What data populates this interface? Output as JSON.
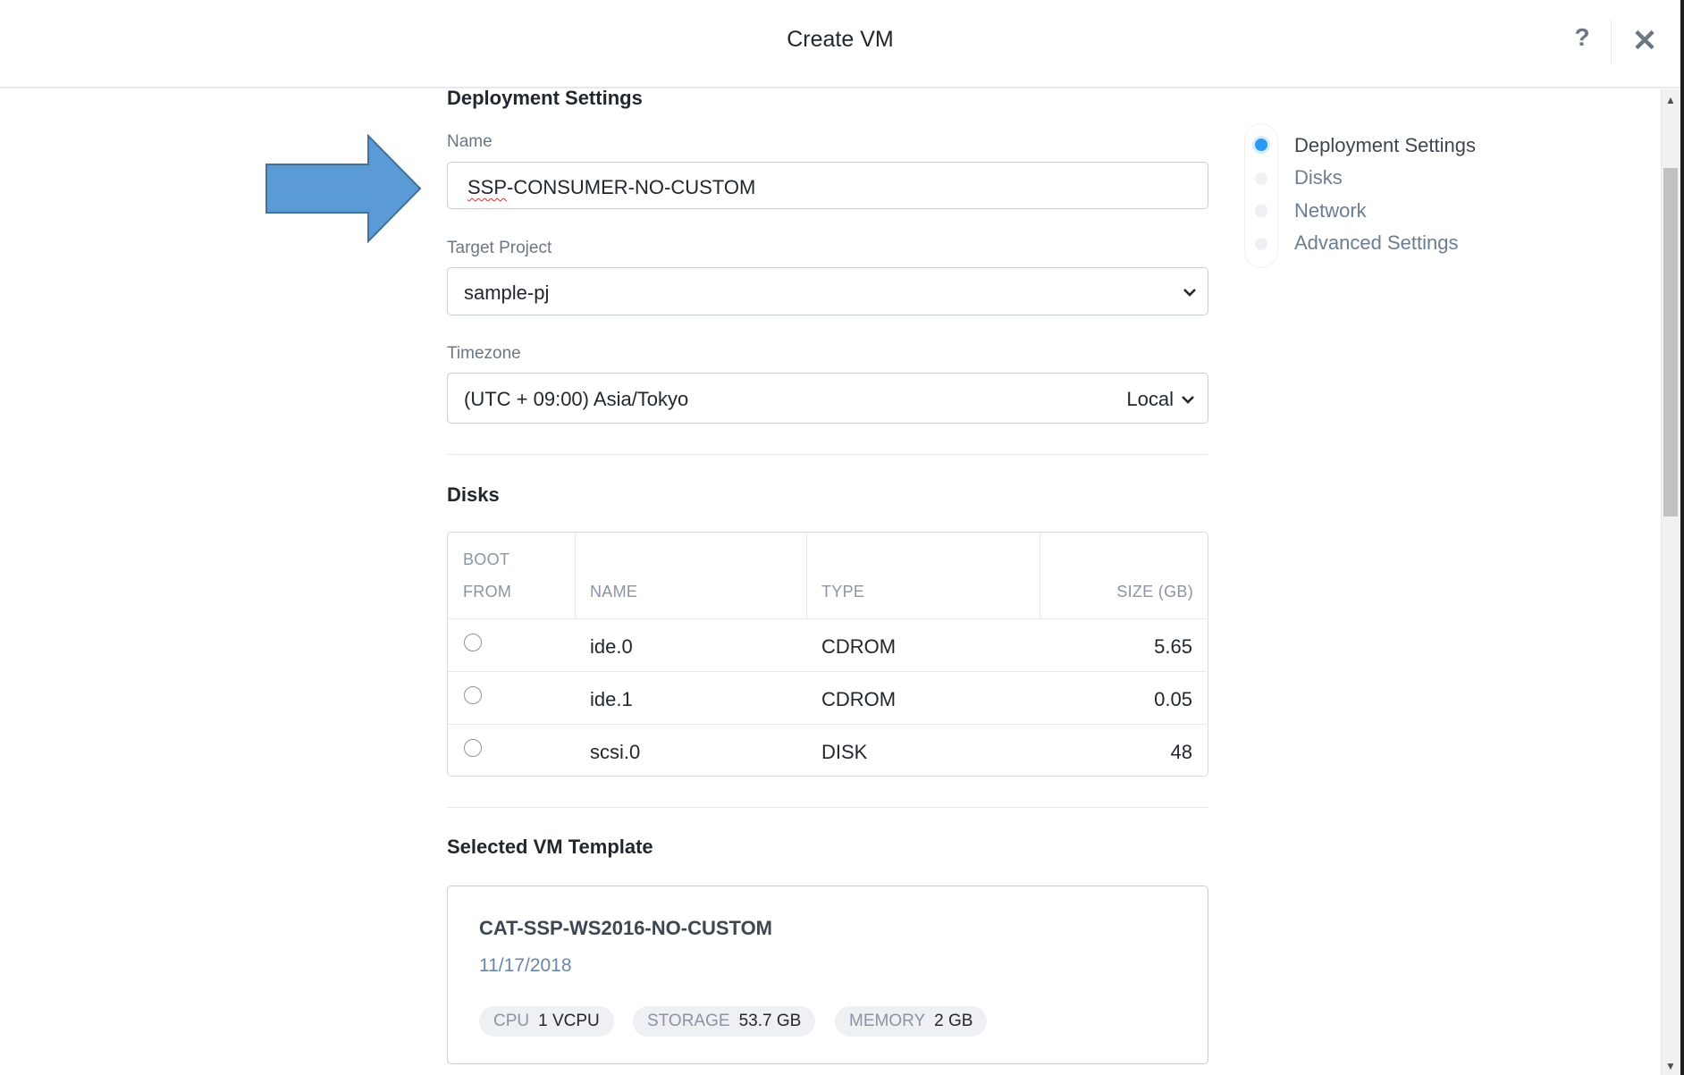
{
  "header": {
    "title": "Create VM",
    "help_label": "?",
    "close_label": "✕"
  },
  "deployment": {
    "section_title": "Deployment Settings",
    "name_label": "Name",
    "name_value_underlined": "SSP",
    "name_value_rest": "-CONSUMER-NO-CUSTOM",
    "project_label": "Target Project",
    "project_value": "sample-pj",
    "timezone_label": "Timezone",
    "timezone_value": "(UTC + 09:00) Asia/Tokyo",
    "timezone_mode": "Local"
  },
  "disks": {
    "section_title": "Disks",
    "columns": {
      "boot_line1": "BOOT",
      "boot_line2": "FROM",
      "name": "NAME",
      "type": "TYPE",
      "size": "SIZE (GB)"
    },
    "rows": [
      {
        "name": "ide.0",
        "type": "CDROM",
        "size": "5.65"
      },
      {
        "name": "ide.1",
        "type": "CDROM",
        "size": "0.05"
      },
      {
        "name": "scsi.0",
        "type": "DISK",
        "size": "48"
      }
    ]
  },
  "template": {
    "section_title": "Selected VM Template",
    "name": "CAT-SSP-WS2016-NO-CUSTOM",
    "date": "11/17/2018",
    "specs": [
      {
        "key": "CPU",
        "value": "1 VCPU"
      },
      {
        "key": "STORAGE",
        "value": "53.7 GB"
      },
      {
        "key": "MEMORY",
        "value": "2 GB"
      }
    ]
  },
  "nav": {
    "items": [
      "Deployment Settings",
      "Disks",
      "Network",
      "Advanced Settings"
    ],
    "active_index": 0
  },
  "colors": {
    "accent": "#2b9af3",
    "arrow_fill": "#5b9bd5",
    "arrow_stroke": "#41719c"
  }
}
